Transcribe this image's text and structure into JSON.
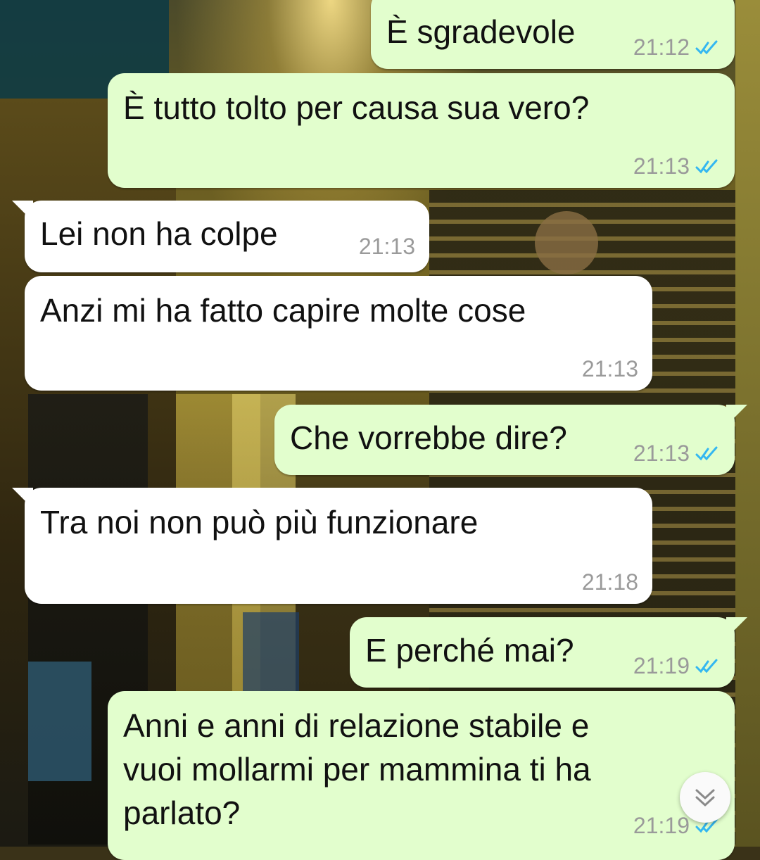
{
  "colors": {
    "outgoing_bubble": "#e2fecd",
    "incoming_bubble": "#ffffff",
    "timestamp": "#9a9a9a",
    "read_ticks": "#34b7f1"
  },
  "messages": [
    {
      "direction": "out",
      "text": "È sgradevole",
      "time": "21:12",
      "status": "read"
    },
    {
      "direction": "out",
      "text": "È tutto tolto per causa sua vero?",
      "time": "21:13",
      "status": "read"
    },
    {
      "direction": "in",
      "text": "Lei non ha colpe",
      "time": "21:13"
    },
    {
      "direction": "in",
      "text": "Anzi mi ha fatto capire molte cose",
      "time": "21:13"
    },
    {
      "direction": "out",
      "text": "Che vorrebbe dire?",
      "time": "21:13",
      "status": "read"
    },
    {
      "direction": "in",
      "text": "Tra noi non può più funzionare",
      "time": "21:18"
    },
    {
      "direction": "out",
      "text": "E perché mai?",
      "time": "21:19",
      "status": "read"
    },
    {
      "direction": "out",
      "text": "Anni e anni di relazione stabile e\nvuoi mollarmi per mammina ti ha\nparlato?",
      "time": "21:19",
      "status": "read"
    }
  ],
  "icons": {
    "read_ticks": "double-check-icon",
    "scroll_down": "chevron-double-down-icon"
  }
}
